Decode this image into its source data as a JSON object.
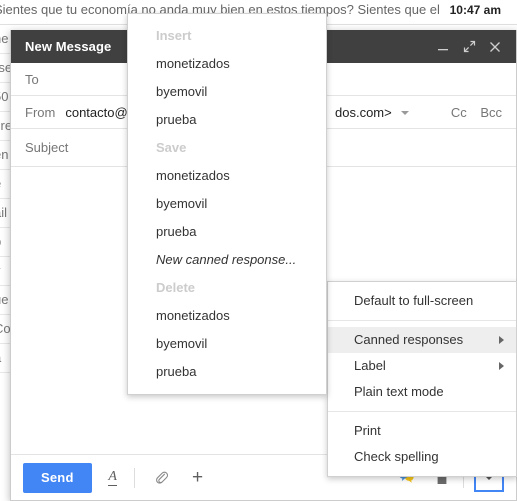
{
  "mail_list": {
    "rows": [
      {
        "snippet": "Sientes que tu economía no anda muy bien en estos tiempos? Sientes que el ",
        "time": "10:47 am"
      },
      {
        "snippet": "ne",
        "time": ""
      },
      {
        "snippet": "rse",
        "time": ""
      },
      {
        "snippet": "50",
        "time": ""
      },
      {
        "snippet": "cre",
        "time": ""
      },
      {
        "snippet": "en",
        "time": ""
      },
      {
        "snippet": "e",
        "time": ""
      },
      {
        "snippet": "ail",
        "time": ""
      },
      {
        "snippet": "p",
        "time": ""
      },
      {
        "snippet": "v",
        "time": ""
      },
      {
        "snippet": "ue",
        "time": ""
      },
      {
        "snippet": "Co",
        "time": ""
      },
      {
        "snippet": "a",
        "time": ""
      }
    ]
  },
  "compose": {
    "title": "New Message",
    "window_buttons": [
      {
        "name": "minimize-button",
        "icon": "minimize-icon"
      },
      {
        "name": "expand-button",
        "icon": "expand-icon"
      },
      {
        "name": "close-button",
        "icon": "close-icon"
      }
    ],
    "to": {
      "label": "To",
      "value": "",
      "placeholder": "To"
    },
    "from": {
      "label": "From",
      "value_left": "contacto@mo",
      "value_right": "dos.com>"
    },
    "cc_label": "Cc",
    "bcc_label": "Bcc",
    "subject": {
      "label": "Subject",
      "value": "",
      "placeholder": "Subject"
    },
    "body": {
      "value": ""
    }
  },
  "toolbar": {
    "send_label": "Send",
    "format_icon": "format-text-icon",
    "attach_icon": "paperclip-icon",
    "insert_icon": "plus-icon",
    "emoji_icon": "emoji-icon",
    "trash_icon": "trash-icon",
    "more_icon": "chevron-down-icon",
    "send_color": "#4285f4",
    "focus_color": "#4285f4"
  },
  "context_menu": {
    "items": [
      {
        "label": "Default to full-screen",
        "submenu": false,
        "active": false,
        "sep_after": true
      },
      {
        "label": "Canned responses",
        "submenu": true,
        "active": true,
        "sep_after": false
      },
      {
        "label": "Label",
        "submenu": true,
        "active": false,
        "sep_after": false
      },
      {
        "label": "Plain text mode",
        "submenu": false,
        "active": false,
        "sep_after": true
      },
      {
        "label": "Print",
        "submenu": false,
        "active": false,
        "sep_after": false
      },
      {
        "label": "Check spelling",
        "submenu": false,
        "active": false,
        "sep_after": false
      }
    ]
  },
  "canned_menu": {
    "entries": [
      {
        "label": "Insert",
        "type": "group"
      },
      {
        "label": "monetizados",
        "type": "item"
      },
      {
        "label": "byemovil",
        "type": "item"
      },
      {
        "label": "prueba",
        "type": "item"
      },
      {
        "label": "Save",
        "type": "group"
      },
      {
        "label": "monetizados",
        "type": "item"
      },
      {
        "label": "byemovil",
        "type": "item"
      },
      {
        "label": "prueba",
        "type": "item"
      },
      {
        "label": "New canned response...",
        "type": "item-italic"
      },
      {
        "label": "Delete",
        "type": "group"
      },
      {
        "label": "monetizados",
        "type": "item"
      },
      {
        "label": "byemovil",
        "type": "item"
      },
      {
        "label": "prueba",
        "type": "item"
      }
    ]
  }
}
